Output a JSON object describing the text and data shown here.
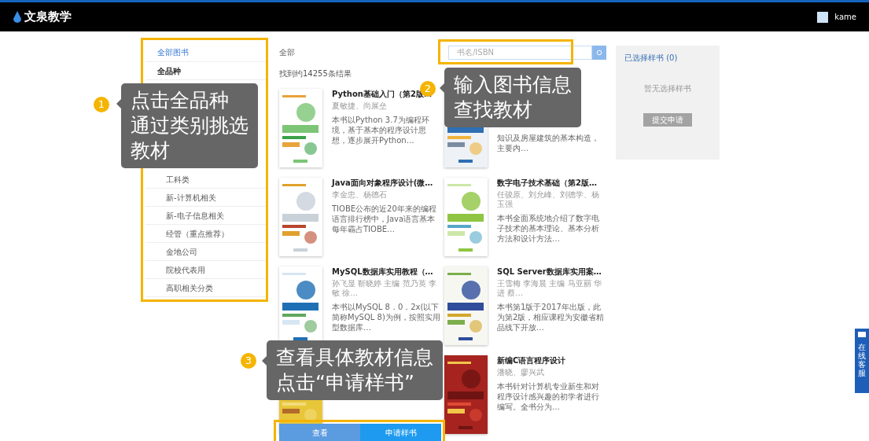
{
  "header": {
    "logo_text": "文泉教学",
    "user": "kame"
  },
  "sidebar": {
    "title": "全部图书",
    "items": [
      {
        "label": "全品种",
        "selected": true
      },
      {
        "label": "工科类",
        "selected": false
      },
      {
        "label": "新-计算机相关",
        "selected": false
      },
      {
        "label": "新-电子信息相关",
        "selected": false
      },
      {
        "label": "经管（重点推荐）",
        "selected": false
      },
      {
        "label": "金地公司",
        "selected": false
      },
      {
        "label": "院校代表用",
        "selected": false
      },
      {
        "label": "高职相关分类",
        "selected": false
      }
    ]
  },
  "breadcrumb": "全部",
  "search": {
    "placeholder": "书名/ISBN"
  },
  "result_count": "找到约14255条结果",
  "books": [
    {
      "title": "Python基础入门（第2版…",
      "authors": "夏敏捷、尚展垒",
      "description": "本书以Python 3.7为编程环境，基于基本的程序设计思想，逐步展开Python…"
    },
    {
      "description": "知识及房屋建筑的基本构造，主要内…"
    },
    {
      "title": "Java面向对象程序设计(微…",
      "authors": "李金忠、杨德石",
      "description": "TIOBE公布的近20年来的编程语言排行榜中，Java语言基本每年霸占TIOBE…"
    },
    {
      "title": "数字电子技术基础（第2版…",
      "authors": "任骏原、刘允峰、刘德学、杨玉强",
      "description": "本书全面系统地介绍了数字电子技术的基本理论、基本分析方法和设计方法…"
    },
    {
      "title": "MySQL数据库实用教程（…",
      "authors": "孙飞显 靳晓婷 主编 范乃英 李敏 徐…",
      "description": "本书以MySQL 8．0．2x(以下简称MySQL 8)为例，按照实用型数据库…"
    },
    {
      "title": "SQL Server数据库实用案…",
      "authors": "王雪梅 李海晨 主编 马亚丽 华进 蔡…",
      "description": "本书第1版于2017年出版，此为第2版，相应课程为安徽省精品线下开放…"
    },
    {
      "hover_actions": [
        "查看",
        "申请样书"
      ]
    },
    {
      "title": "新编C语言程序设计",
      "authors": "潘晓、廖兴武",
      "description": "本书针对计算机专业新生和对程序设计感兴趣的初学者进行编写。全书分为…"
    }
  ],
  "selected_panel": {
    "title": "已选择样书 (0)",
    "empty_text": "暂无选择样书",
    "submit": "提交申请"
  },
  "chat_widget": {
    "label": "在线客服"
  },
  "callouts": [
    {
      "number": "1",
      "lines": [
        "点击全品种",
        "通过类别挑选",
        "教材"
      ]
    },
    {
      "number": "2",
      "lines": [
        "输入图书信息",
        "查找教材"
      ]
    },
    {
      "number": "3",
      "lines": [
        "查看具体教材信息",
        "点击“申请样书”"
      ]
    }
  ]
}
